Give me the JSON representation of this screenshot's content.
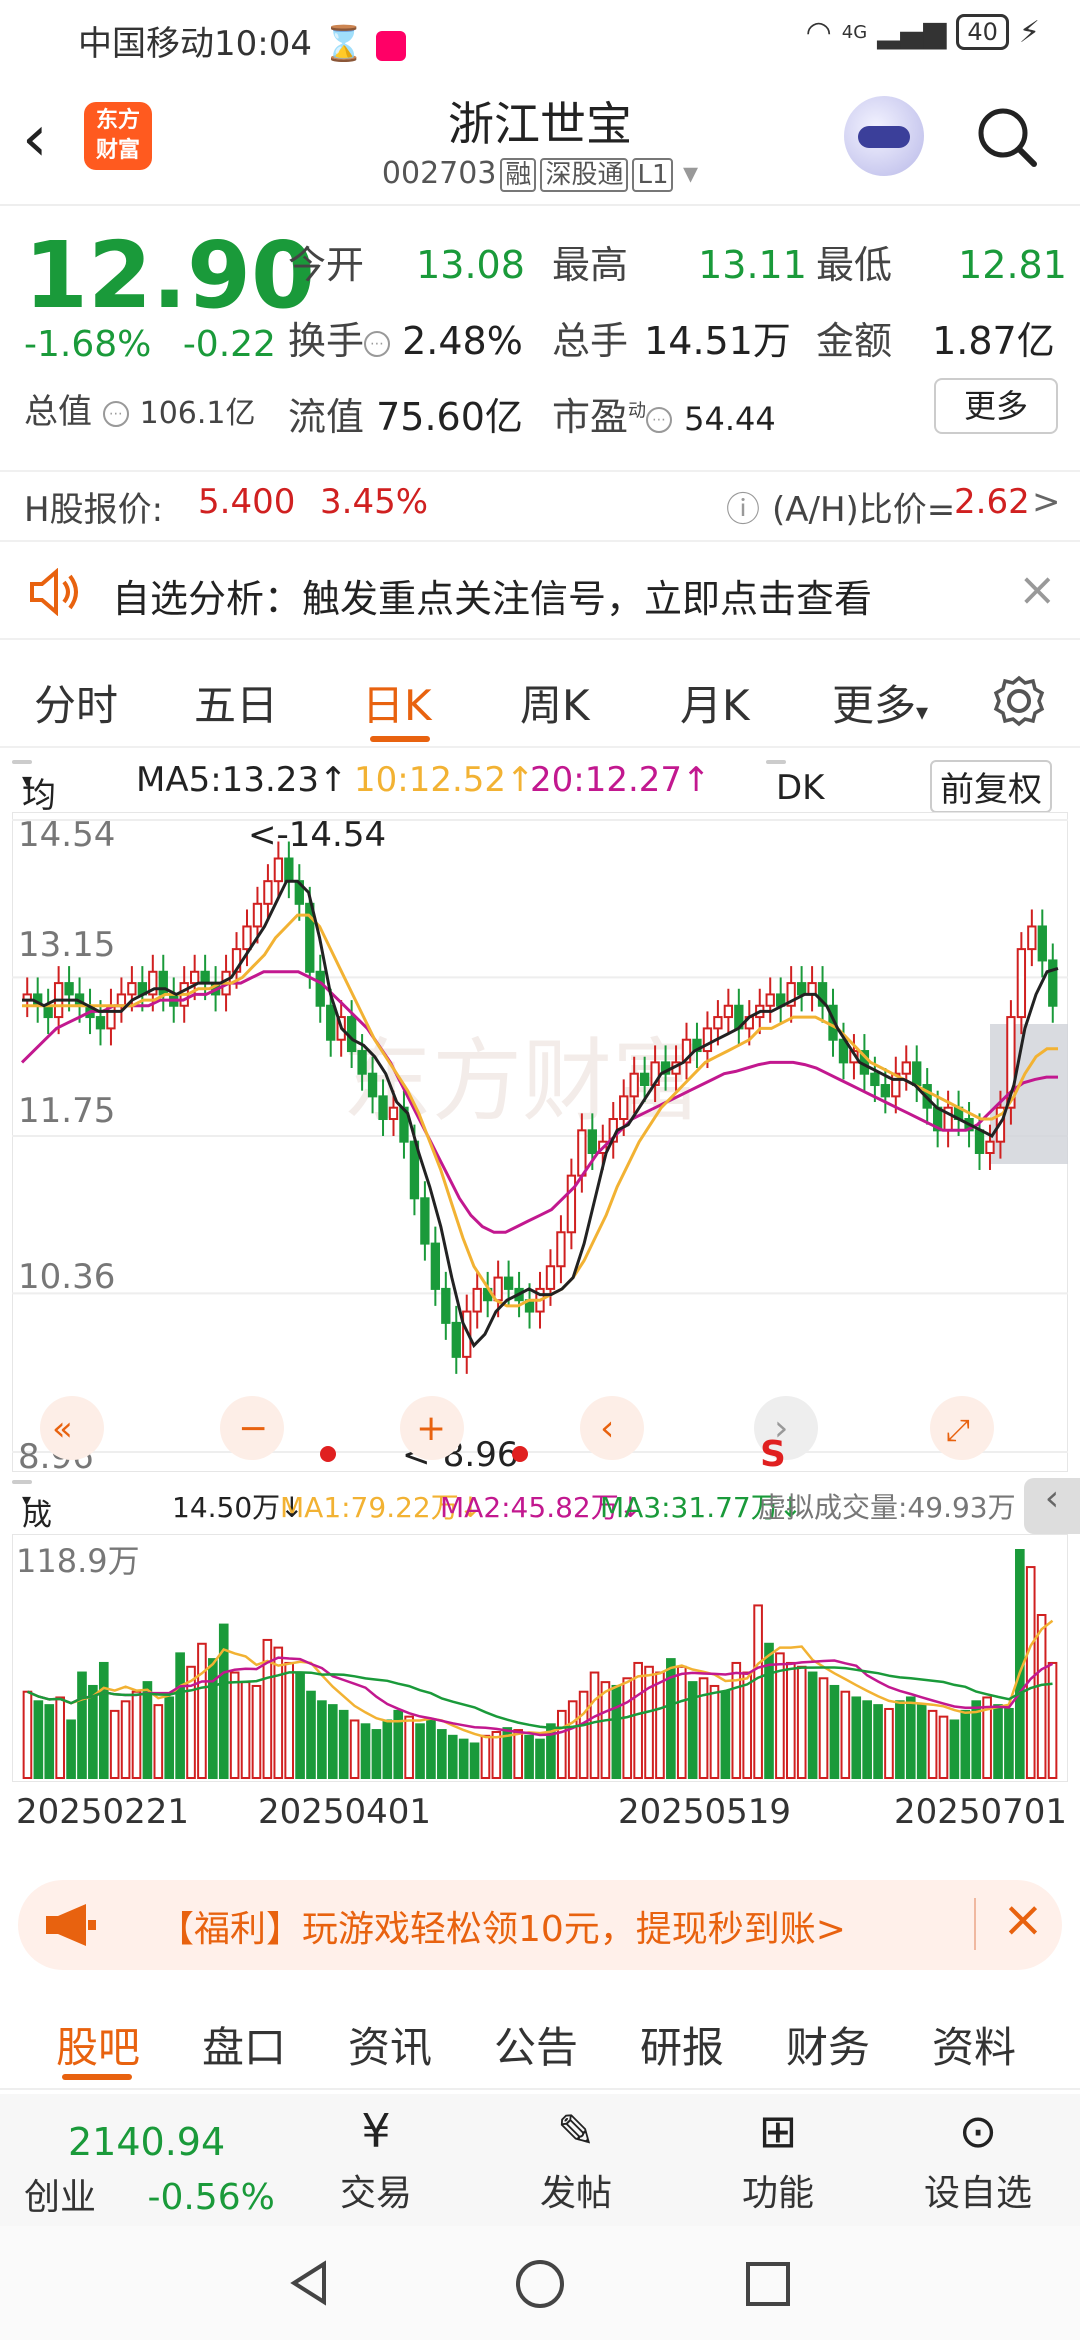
{
  "status": {
    "carrier": "中国移动",
    "time": "10:04",
    "network": "4G",
    "battery": "40"
  },
  "header": {
    "back_icon": "back-arrow-icon",
    "app_logo": "东方\n财富",
    "name": "浙江世宝",
    "code": "002703",
    "tags": [
      "融",
      "深股通",
      "L1"
    ]
  },
  "quote": {
    "price": "12.90",
    "change_pct": "-1.68%",
    "change_amt": "-0.22",
    "open_label": "今开",
    "open": "13.08",
    "high_label": "最高",
    "high": "13.11",
    "low_label": "最低",
    "low": "12.81",
    "turnover_label": "换手",
    "turnover": "2.48%",
    "volume_label": "总手",
    "volume": "14.51万",
    "amount_label": "金额",
    "amount": "1.87亿",
    "mcap_label": "总值",
    "mcap": "106.1亿",
    "float_label": "流值",
    "float": "75.60亿",
    "pe_label": "市盈",
    "pe_sup": "动",
    "pe": "54.44",
    "more": "更多",
    "colors": {
      "down": "#1a9a3a",
      "up": "#d02020",
      "accent": "#e8620f"
    }
  },
  "hshare": {
    "label": "H股报价:",
    "price": "5.400",
    "pct": "3.45%",
    "ah_label": "(A/H)比价=",
    "ah": "2.62",
    "arrow": ">"
  },
  "notice": {
    "text": "自选分析：触发重点关注信号，立即点击查看"
  },
  "tabs": [
    "分时",
    "五日",
    "日K",
    "周K",
    "月K",
    "更多"
  ],
  "ma": {
    "selector": "均线",
    "ma5": "MA5:13.23↑",
    "ma10": "10:12.52↑",
    "ma20": "20:12.27↑",
    "dk": "DK点",
    "adjust": "前复权"
  },
  "chart_data": {
    "type": "candlestick",
    "y_ticks": [
      "14.54",
      "13.15",
      "11.75",
      "10.36",
      "8.96"
    ],
    "max_label": "<-14.54",
    "min_label": "<-8.96",
    "ylim": [
      8.96,
      14.54
    ],
    "close": [
      13.0,
      12.9,
      12.8,
      13.1,
      13.0,
      12.9,
      12.8,
      12.7,
      12.9,
      13.0,
      13.1,
      13.0,
      13.2,
      13.0,
      12.9,
      13.1,
      13.2,
      13.1,
      13.0,
      13.2,
      13.4,
      13.6,
      13.8,
      14.0,
      14.2,
      14.0,
      13.8,
      13.2,
      12.9,
      12.6,
      12.8,
      12.5,
      12.3,
      12.1,
      11.9,
      12.0,
      11.7,
      11.2,
      10.8,
      10.4,
      10.1,
      9.8,
      10.2,
      10.4,
      10.3,
      10.5,
      10.4,
      10.3,
      10.2,
      10.4,
      10.6,
      10.9,
      11.4,
      11.8,
      11.6,
      11.7,
      11.9,
      12.1,
      12.3,
      12.2,
      12.4,
      12.3,
      12.4,
      12.6,
      12.5,
      12.7,
      12.8,
      12.9,
      12.7,
      12.8,
      12.9,
      13.0,
      12.9,
      13.1,
      13.0,
      13.1,
      12.9,
      12.6,
      12.4,
      12.5,
      12.3,
      12.2,
      12.1,
      12.3,
      12.4,
      12.2,
      12.0,
      11.8,
      12.0,
      11.9,
      11.8,
      11.6,
      11.7,
      12.0,
      12.8,
      13.4,
      13.6,
      13.3,
      12.9
    ],
    "ma5": [
      12.95,
      12.95,
      12.9,
      12.95,
      12.95,
      12.95,
      12.9,
      12.85,
      12.85,
      12.85,
      12.95,
      13.0,
      13.05,
      13.05,
      13.0,
      13.05,
      13.1,
      13.1,
      13.1,
      13.15,
      13.3,
      13.45,
      13.6,
      13.8,
      14.0,
      14.0,
      13.9,
      13.5,
      13.0,
      12.7,
      12.6,
      12.55,
      12.45,
      12.3,
      12.05,
      11.95,
      11.6,
      11.3,
      10.95,
      10.5,
      10.1,
      9.9,
      10.0,
      10.2,
      10.3,
      10.35,
      10.4,
      10.35,
      10.35,
      10.4,
      10.5,
      10.8,
      11.2,
      11.6,
      11.8,
      11.85,
      12.0,
      12.15,
      12.3,
      12.35,
      12.4,
      12.5,
      12.55,
      12.6,
      12.65,
      12.7,
      12.8,
      12.85,
      12.85,
      12.9,
      12.95,
      13.0,
      13.0,
      12.9,
      12.7,
      12.55,
      12.4,
      12.35,
      12.3,
      12.25,
      12.25,
      12.2,
      12.1,
      12.0,
      11.95,
      11.9,
      11.85,
      11.8,
      11.75,
      11.9,
      12.2,
      12.7,
      13.0,
      13.2,
      13.23
    ],
    "ma10": [
      12.9,
      12.9,
      12.9,
      12.9,
      12.9,
      12.9,
      12.9,
      12.9,
      12.9,
      12.9,
      12.9,
      12.95,
      12.95,
      13.0,
      13.0,
      13.0,
      13.05,
      13.05,
      13.1,
      13.1,
      13.15,
      13.25,
      13.35,
      13.5,
      13.6,
      13.7,
      13.7,
      13.6,
      13.4,
      13.2,
      13.0,
      12.8,
      12.6,
      12.45,
      12.3,
      12.15,
      11.95,
      11.7,
      11.45,
      11.15,
      10.85,
      10.6,
      10.45,
      10.3,
      10.25,
      10.25,
      10.3,
      10.3,
      10.35,
      10.4,
      10.5,
      10.65,
      10.85,
      11.05,
      11.3,
      11.5,
      11.7,
      11.85,
      12.0,
      12.1,
      12.2,
      12.3,
      12.4,
      12.45,
      12.5,
      12.55,
      12.6,
      12.7,
      12.7,
      12.75,
      12.8,
      12.8,
      12.8,
      12.75,
      12.7,
      12.6,
      12.5,
      12.4,
      12.35,
      12.3,
      12.25,
      12.2,
      12.15,
      12.1,
      12.05,
      12.0,
      11.95,
      11.9,
      11.9,
      11.95,
      12.1,
      12.3,
      12.45,
      12.52,
      12.52
    ],
    "ma20": [
      12.4,
      12.5,
      12.6,
      12.7,
      12.75,
      12.8,
      12.85,
      12.85,
      12.9,
      12.9,
      12.9,
      12.9,
      12.95,
      12.95,
      12.95,
      13.0,
      13.0,
      13.05,
      13.1,
      13.1,
      13.15,
      13.2,
      13.2,
      13.2,
      13.2,
      13.15,
      13.1,
      13.0,
      12.9,
      12.8,
      12.7,
      12.55,
      12.4,
      12.2,
      12.0,
      11.8,
      11.6,
      11.4,
      11.2,
      11.05,
      10.95,
      10.9,
      10.9,
      10.95,
      11.0,
      11.05,
      11.1,
      11.2,
      11.3,
      11.45,
      11.6,
      11.7,
      11.8,
      11.9,
      11.95,
      12.0,
      12.05,
      12.1,
      12.15,
      12.2,
      12.25,
      12.3,
      12.32,
      12.35,
      12.38,
      12.4,
      12.4,
      12.4,
      12.38,
      12.35,
      12.3,
      12.25,
      12.2,
      12.15,
      12.1,
      12.05,
      12.0,
      11.95,
      11.9,
      11.85,
      11.8,
      11.8,
      11.8,
      11.85,
      11.95,
      12.05,
      12.15,
      12.22,
      12.25,
      12.27,
      12.27
    ],
    "volume": [
      45,
      40,
      38,
      42,
      30,
      55,
      48,
      60,
      35,
      40,
      45,
      50,
      38,
      42,
      65,
      58,
      70,
      62,
      80,
      55,
      50,
      48,
      72,
      68,
      60,
      55,
      45,
      40,
      38,
      35,
      30,
      28,
      25,
      30,
      35,
      32,
      28,
      30,
      25,
      22,
      20,
      18,
      22,
      24,
      26,
      25,
      22,
      20,
      28,
      35,
      40,
      45,
      55,
      50,
      48,
      52,
      60,
      58,
      55,
      62,
      58,
      50,
      52,
      48,
      45,
      60,
      55,
      90,
      70,
      65,
      60,
      58,
      55,
      52,
      48,
      45,
      42,
      40,
      38,
      36,
      40,
      42,
      38,
      35,
      32,
      30,
      35,
      40,
      42,
      38,
      36,
      118.9,
      110,
      85,
      60
    ],
    "vol_max_label": "118.9万",
    "dates": [
      "20250221",
      "20250401",
      "20250519",
      "20250701"
    ]
  },
  "vol_bar": {
    "selector": "成交量",
    "vol": "14.50万↓",
    "ma1": "MA1:79.22万↓",
    "ma2": "MA2:45.82万↓",
    "ma3": "MA3:31.77万↓",
    "virtual": "虚拟成交量:49.93万"
  },
  "banner": {
    "text": "【福利】玩游戏轻松领10元，提现秒到账>"
  },
  "subtabs": [
    "股吧",
    "盘口",
    "资讯",
    "公告",
    "研报",
    "财务",
    "资料"
  ],
  "bottom": {
    "index_value": "2140.94",
    "index_name": "创业",
    "index_pct": "-0.56%",
    "items": [
      "交易",
      "发帖",
      "功能",
      "设自选"
    ]
  }
}
